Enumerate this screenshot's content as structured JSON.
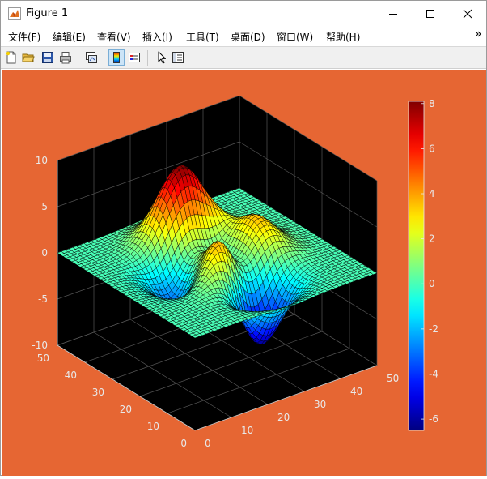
{
  "window": {
    "title": "Figure 1",
    "app_icon": "matlab-icon",
    "controls": [
      "minimize-icon",
      "maximize-icon",
      "close-icon"
    ]
  },
  "menubar": {
    "items": [
      {
        "label": "文件(F)"
      },
      {
        "label": "编辑(E)"
      },
      {
        "label": "查看(V)"
      },
      {
        "label": "插入(I)"
      },
      {
        "label": "工具(T)"
      },
      {
        "label": "桌面(D)"
      },
      {
        "label": "窗口(W)"
      },
      {
        "label": "帮助(H)"
      }
    ],
    "overflow_icon": "chevron-more-icon"
  },
  "toolbar": {
    "buttons": [
      "new-figure-icon",
      "open-file-icon",
      "save-icon",
      "print-icon",
      "link-plot-icon",
      "colorbar-icon",
      "legend-icon",
      "edit-plot-arrow-icon",
      "property-inspector-icon"
    ],
    "active": "colorbar-icon"
  },
  "chart_data": {
    "type": "surface",
    "function": "peaks",
    "colormap": "jet",
    "background_color": "#e66633",
    "axes_color": "#000000",
    "grid": true,
    "x_ticks": [
      "0",
      "10",
      "20",
      "30",
      "40",
      "50"
    ],
    "y_ticks": [
      "0",
      "10",
      "20",
      "30",
      "40",
      "50"
    ],
    "z_ticks": [
      "10",
      "5",
      "0",
      "-5",
      "-10"
    ],
    "xlim": [
      0,
      50
    ],
    "ylim": [
      0,
      50
    ],
    "zlim": [
      -10,
      10
    ],
    "colorbar": {
      "ticks": [
        "8",
        "6",
        "4",
        "2",
        "0",
        "-2",
        "-4",
        "-6"
      ],
      "clim": [
        -6.5,
        8.1
      ]
    }
  }
}
